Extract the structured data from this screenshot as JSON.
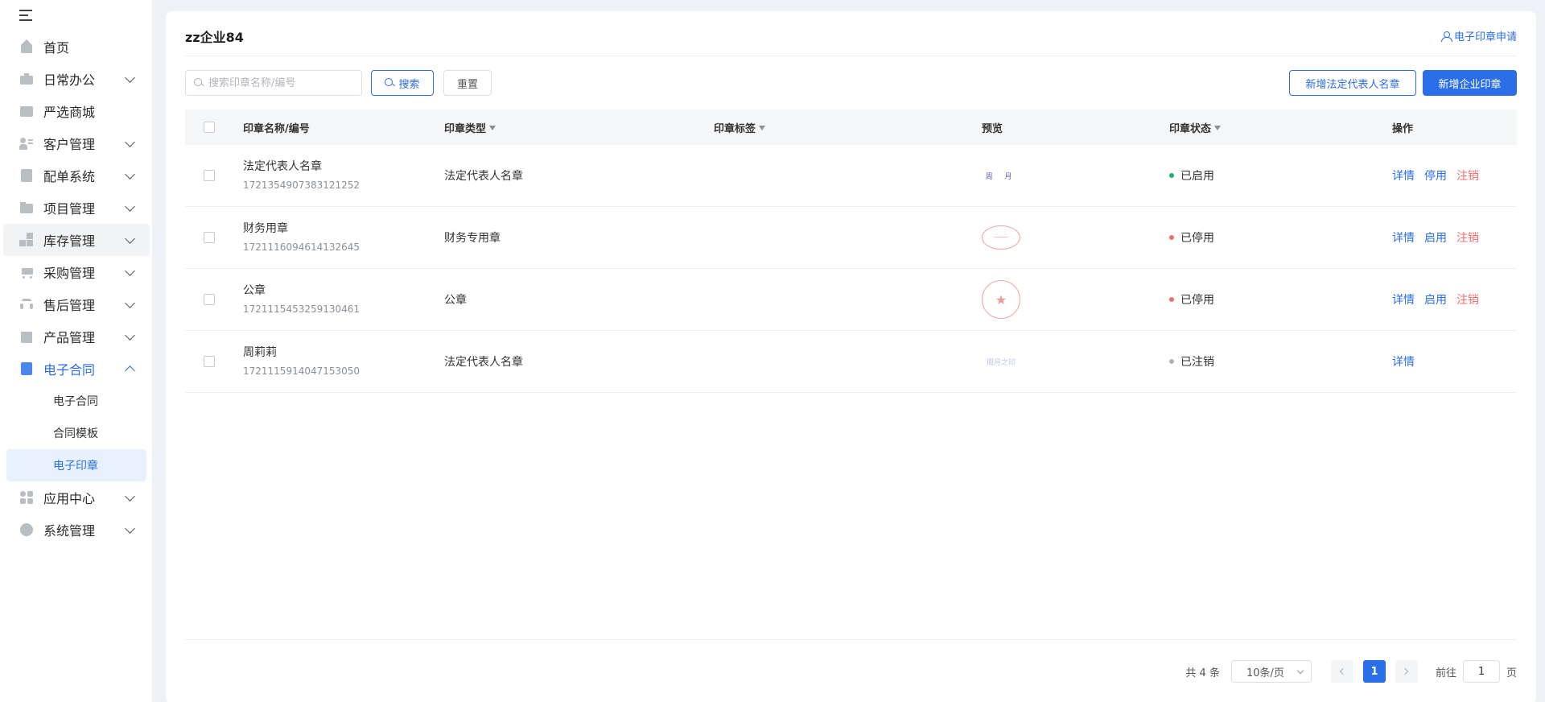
{
  "sidebar": {
    "items": [
      {
        "label": "首页",
        "icon": "home-icon",
        "chevron": false
      },
      {
        "label": "日常办公",
        "icon": "briefcase-icon",
        "chevron": true
      },
      {
        "label": "严选商城",
        "icon": "store-icon",
        "chevron": false
      },
      {
        "label": "客户管理",
        "icon": "customer-icon",
        "chevron": true
      },
      {
        "label": "配单系统",
        "icon": "order-icon",
        "chevron": true
      },
      {
        "label": "项目管理",
        "icon": "folder-icon",
        "chevron": true
      },
      {
        "label": "库存管理",
        "icon": "inventory-icon",
        "chevron": true
      },
      {
        "label": "采购管理",
        "icon": "cart-icon",
        "chevron": true
      },
      {
        "label": "售后管理",
        "icon": "headset-icon",
        "chevron": true
      },
      {
        "label": "产品管理",
        "icon": "box-icon",
        "chevron": true
      },
      {
        "label": "电子合同",
        "icon": "contract-icon",
        "chevron": true,
        "open": true
      },
      {
        "label": "应用中心",
        "icon": "apps-icon",
        "chevron": true
      },
      {
        "label": "系统管理",
        "icon": "settings-icon",
        "chevron": true
      }
    ],
    "sub_items": [
      {
        "label": "电子合同"
      },
      {
        "label": "合同模板"
      },
      {
        "label": "电子印章",
        "active": true
      }
    ]
  },
  "header": {
    "title": "zz企业84",
    "apply_link": "电子印章申请"
  },
  "toolbar": {
    "search_placeholder": "搜索印章名称/编号",
    "search_label": "搜索",
    "reset_label": "重置",
    "add_legal_label": "新增法定代表人名章",
    "add_company_label": "新增企业印章"
  },
  "table": {
    "columns": [
      "印章名称/编号",
      "印章类型",
      "印章标签",
      "预览",
      "印章状态",
      "操作"
    ],
    "rows": [
      {
        "name": "法定代表人名章",
        "code": "1721354907383121252",
        "type": "法定代表人名章",
        "tag": "",
        "preview": "周 月",
        "status": "已启用",
        "status_color": "#19b26b",
        "ops": [
          "详情",
          "停用",
          "注销"
        ]
      },
      {
        "name": "财务用章",
        "code": "1721116094614132645",
        "type": "财务专用章",
        "tag": "",
        "preview": "",
        "status": "已停用",
        "status_color": "#f56c6c",
        "ops": [
          "详情",
          "启用",
          "注销"
        ]
      },
      {
        "name": "公章",
        "code": "1721115453259130461",
        "type": "公章",
        "tag": "",
        "preview": "★",
        "status": "已停用",
        "status_color": "#f56c6c",
        "ops": [
          "详情",
          "启用",
          "注销"
        ]
      },
      {
        "name": "周莉莉",
        "code": "1721115914047153050",
        "type": "法定代表人名章",
        "tag": "",
        "preview": "周月之印",
        "status": "已注销",
        "status_color": "#b0b3b8",
        "ops": [
          "详情"
        ]
      }
    ]
  },
  "pagination": {
    "total": "共 4 条",
    "page_size": "10条/页",
    "current_page": "1",
    "goto_label": "前往",
    "goto_value": "1",
    "page_suffix": "页"
  },
  "colors": {
    "accent": "#2a6ee8",
    "danger": "#f56c6c",
    "success": "#19b26b"
  }
}
